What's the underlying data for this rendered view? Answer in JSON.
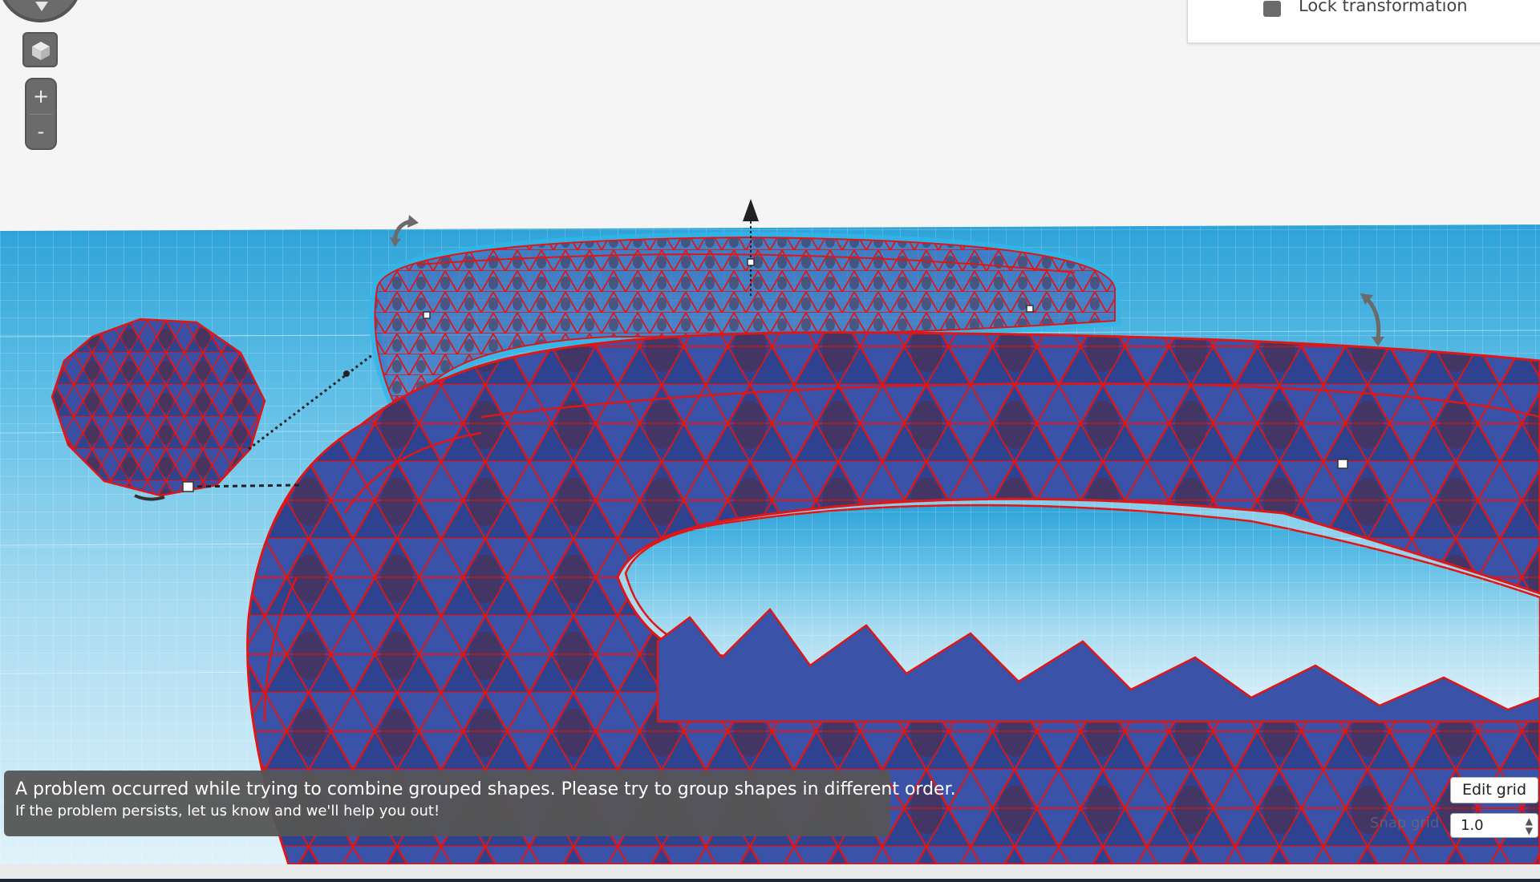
{
  "properties_panel": {
    "lock_label": "Lock transformation"
  },
  "view_controls": {
    "zoom_in": "+",
    "zoom_out": "-"
  },
  "error_toast": {
    "message": "A problem occurred while trying to combine grouped shapes. Please try to group shapes in different order.",
    "detail": "If the problem persists, let us know and we'll help you out!"
  },
  "grid_controls": {
    "edit_grid_label": "Edit grid",
    "snap_grid_label": "Snap grid",
    "snap_grid_value": "1.0"
  },
  "colors": {
    "workplane": "#3aa9dc",
    "shape_fill": "#3a4fa3",
    "shape_edge": "#e01616",
    "selection_halo": "#2fb5ea"
  }
}
